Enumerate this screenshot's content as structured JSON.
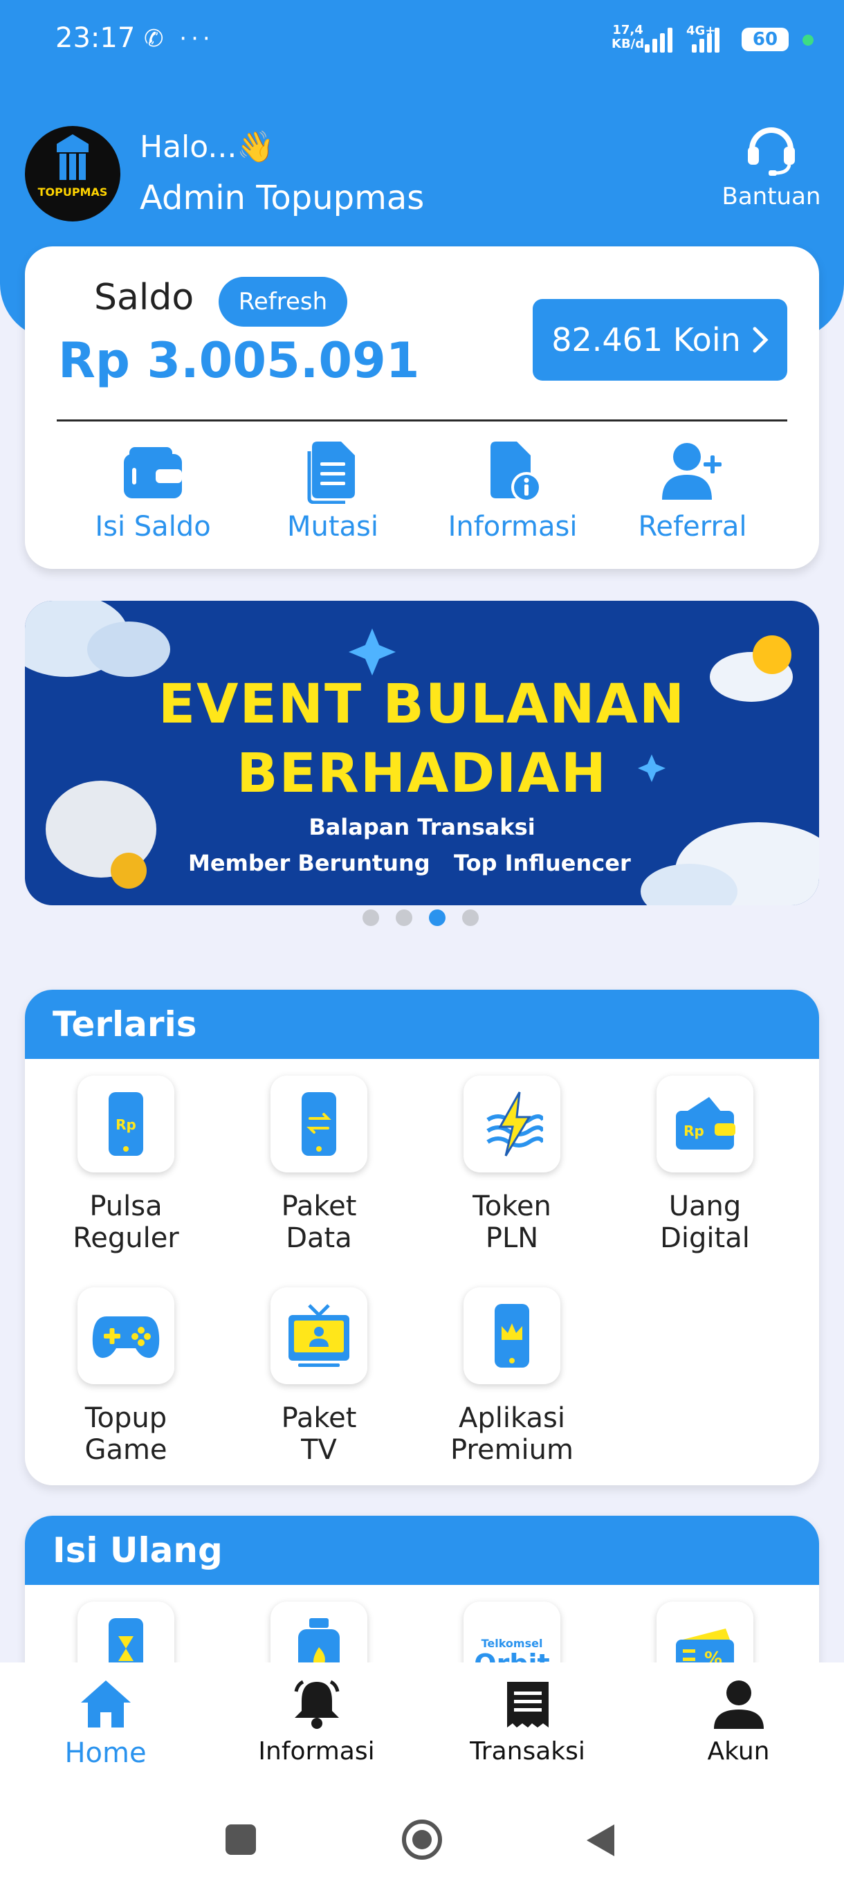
{
  "status_bar": {
    "time": "23:17",
    "left_icons": "✆ ···",
    "speed_value": "17,4",
    "speed_unit": "KB/d",
    "network": "4G+",
    "battery": "60"
  },
  "header": {
    "logo_text": "TOPUPMAS",
    "greeting": "Halo...👋",
    "user_name": "Admin Topupmas",
    "help_label": "Bantuan",
    "help_icon": "headset-icon"
  },
  "balance_card": {
    "label": "Saldo",
    "refresh_label": "Refresh",
    "amount": "Rp 3.005.091",
    "coins": "82.461 Koin",
    "menu": [
      {
        "label": "Isi Saldo",
        "icon": "wallet-icon"
      },
      {
        "label": "Mutasi",
        "icon": "document-icon"
      },
      {
        "label": "Informasi",
        "icon": "info-document-icon"
      },
      {
        "label": "Referral",
        "icon": "add-user-icon"
      }
    ]
  },
  "banner": {
    "title_line1": "EVENT  BULANAN",
    "title_line2": "BERHADIAH",
    "line1": "Balapan Transaksi",
    "line2_left": "Member Beruntung",
    "line2_right": "Top Influencer",
    "active_slide": 3,
    "slide_count": 4
  },
  "terlaris": {
    "title": "Terlaris",
    "items": [
      {
        "line1": "Pulsa",
        "line2": "Reguler",
        "icon": "phone-rupiah-icon"
      },
      {
        "line1": "Paket",
        "line2": "Data",
        "icon": "phone-data-icon"
      },
      {
        "line1": "Token",
        "line2": "PLN",
        "icon": "lightning-icon"
      },
      {
        "line1": "Uang",
        "line2": "Digital",
        "icon": "digital-wallet-icon"
      },
      {
        "line1": "Topup",
        "line2": "Game",
        "icon": "gamepad-icon"
      },
      {
        "line1": "Paket",
        "line2": "TV",
        "icon": "tv-icon"
      },
      {
        "line1": "Aplikasi",
        "line2": "Premium",
        "icon": "phone-crown-icon"
      }
    ]
  },
  "isi_ulang": {
    "title": "Isi Ulang",
    "items": [
      {
        "icon": "phone-hourglass-icon"
      },
      {
        "icon": "gas-cylinder-icon"
      },
      {
        "icon": "orbit-logo-icon",
        "text_top": "Telkomsel",
        "text_main": "Orbit"
      },
      {
        "icon": "voucher-icon"
      }
    ]
  },
  "bottom_nav": [
    {
      "label": "Home",
      "icon": "home-icon",
      "active": true
    },
    {
      "label": "Informasi",
      "icon": "bell-icon",
      "active": false
    },
    {
      "label": "Transaksi",
      "icon": "receipt-icon",
      "active": false
    },
    {
      "label": "Akun",
      "icon": "user-icon",
      "active": false
    }
  ],
  "colors": {
    "primary": "#2a93ee",
    "banner_bg": "#0f3f9a",
    "banner_text": "#ffe61a",
    "page_bg": "#eef0fb"
  }
}
